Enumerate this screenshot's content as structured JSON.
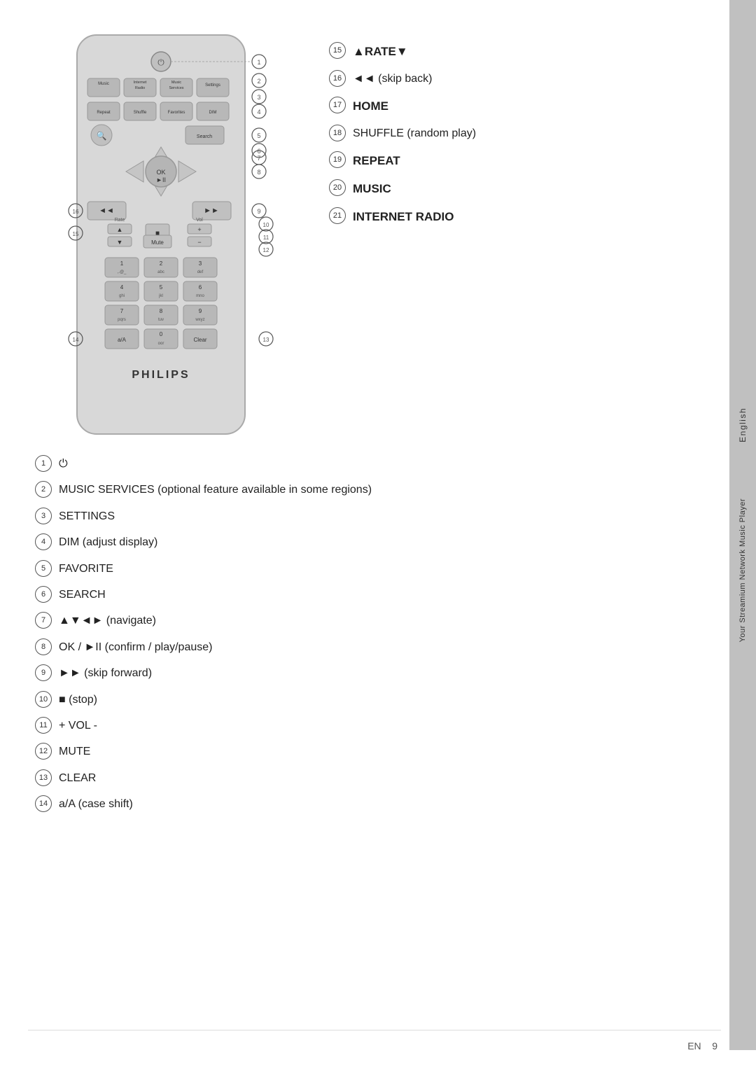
{
  "page": {
    "number": "9",
    "lang": "EN"
  },
  "sidebar": {
    "lang_text": "English",
    "product_text": "Your Streamium Network Music Player"
  },
  "right_annotations": [
    {
      "num": "15",
      "text": "▲RATE▼",
      "bold": true
    },
    {
      "num": "16",
      "text": "◄◄ (skip back)"
    },
    {
      "num": "17",
      "text": "HOME",
      "bold": true
    },
    {
      "num": "18",
      "text": "SHUFFLE (random play)"
    },
    {
      "num": "19",
      "text": "REPEAT",
      "bold": true
    },
    {
      "num": "20",
      "text": "MUSIC",
      "bold": true
    },
    {
      "num": "21",
      "text": "INTERNET RADIO",
      "bold": true
    }
  ],
  "bottom_annotations": [
    {
      "num": "1",
      "text": "⏻",
      "icon": true
    },
    {
      "num": "2",
      "text": "MUSIC SERVICES (optional feature available in some regions)"
    },
    {
      "num": "3",
      "text": "SETTINGS"
    },
    {
      "num": "4",
      "text": "DIM (adjust display)"
    },
    {
      "num": "5",
      "text": "FAVORITE"
    },
    {
      "num": "6",
      "text": "SEARCH"
    },
    {
      "num": "7",
      "text": "▲▼◄► (navigate)"
    },
    {
      "num": "8",
      "text": "OK / ►II (confirm / play/pause)"
    },
    {
      "num": "9",
      "text": "►► (skip forward)"
    },
    {
      "num": "10",
      "text": "■ (stop)"
    },
    {
      "num": "11",
      "text": "+ VOL -"
    },
    {
      "num": "12",
      "text": "MUTE"
    },
    {
      "num": "13",
      "text": "CLEAR"
    },
    {
      "num": "14",
      "text": "a/A (case shift)"
    }
  ],
  "remote": {
    "brand": "PHILIPS",
    "buttons": {
      "power": "⏻",
      "top_row": [
        "Music",
        "Internet Radio",
        "Music Services",
        "Settings"
      ],
      "second_row": [
        "Repeat",
        "Shuffle",
        "Favorites",
        "DIM"
      ],
      "nav": "OK►II",
      "search": "Search",
      "skip_back": "◄◄",
      "skip_forward": "►►",
      "stop": "■",
      "rate_label": "Rate",
      "mute": "Mute",
      "numpad": [
        "1\n,.@_",
        "2\nabc",
        "3\ndef",
        "4\nghi",
        "5\njkl",
        "6\nmno",
        "7\npqrs",
        "8\ntuv",
        "9\nwxyz"
      ],
      "bottom_row": [
        "a/A",
        "0\noor",
        "Clear"
      ]
    }
  }
}
